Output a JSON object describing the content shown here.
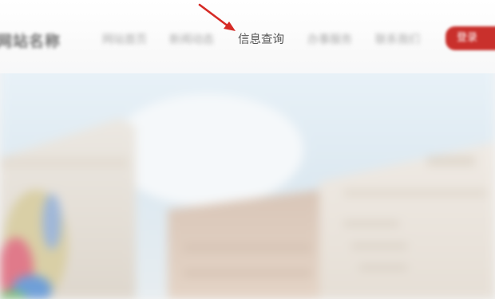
{
  "header": {
    "logo_text": "网站名称",
    "nav": [
      {
        "label": "网站首页"
      },
      {
        "label": "新闻动态"
      },
      {
        "label": "信息查询"
      },
      {
        "label": "办事服务"
      },
      {
        "label": "联系我们"
      }
    ],
    "cta_label": "登录"
  },
  "annotation": {
    "arrow_color": "#d62b26",
    "points_to": "信息查询"
  },
  "colors": {
    "accent": "#c9302c",
    "nav_active_text": "#555555",
    "nav_blurred_text": "#a9a9a9"
  }
}
